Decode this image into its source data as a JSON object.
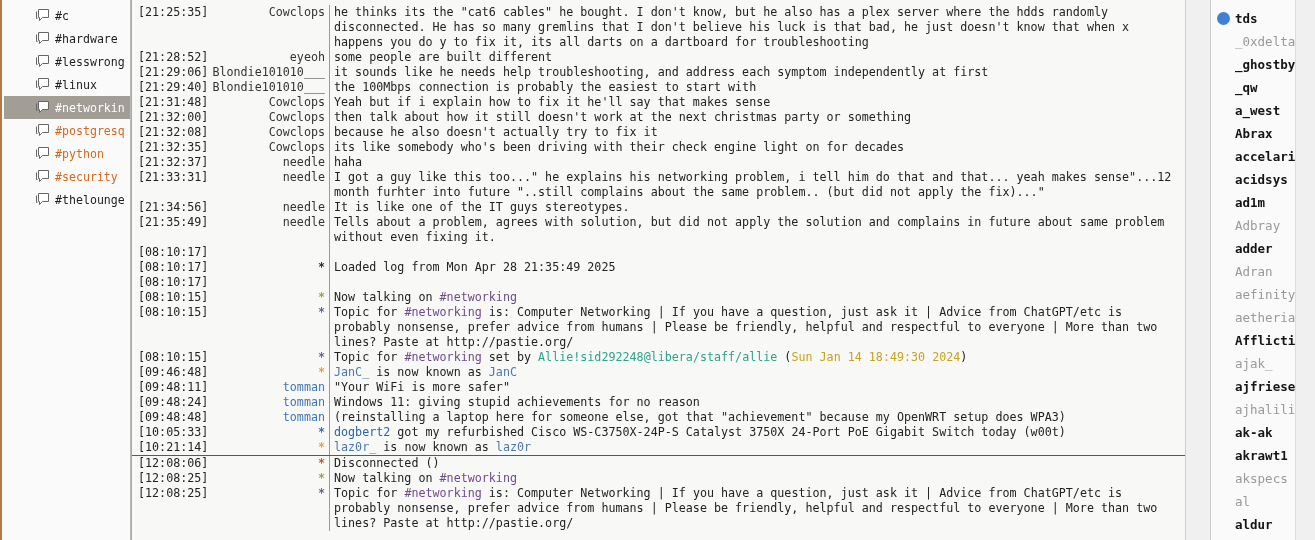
{
  "channels": [
    {
      "name": "#c",
      "selected": false,
      "color": "#1e1e1e"
    },
    {
      "name": "#hardware",
      "selected": false,
      "color": "#1e1e1e"
    },
    {
      "name": "#lesswrong",
      "selected": false,
      "color": "#1e1e1e"
    },
    {
      "name": "#linux",
      "selected": false,
      "color": "#1e1e1e"
    },
    {
      "name": "#networkin",
      "selected": true,
      "color": "#ffffff"
    },
    {
      "name": "#postgresq",
      "selected": false,
      "color": "#d2691e"
    },
    {
      "name": "#python",
      "selected": false,
      "color": "#d2691e"
    },
    {
      "name": "#security",
      "selected": false,
      "color": "#d2691e"
    },
    {
      "name": "#thelounge",
      "selected": false,
      "color": "#1e1e1e"
    }
  ],
  "chat": [
    {
      "kind": "message",
      "time": "[21:25:35]",
      "nick": "Cowclops",
      "color": "#333333",
      "parts": [
        {
          "text": "he thinks its the \"cat6 cables\" he bought. I don't know, but he also has a plex server where the hdds randomly disconnected. He has so many gremlins that I don't believe his luck is that bad, he just doesn't know that when x happens you do y to fix it, its all darts on a dartboard for troubleshooting"
        }
      ]
    },
    {
      "kind": "message",
      "time": "[21:28:52]",
      "nick": "eyeoh",
      "color": "#333333",
      "parts": [
        {
          "text": "some people are built different"
        }
      ]
    },
    {
      "kind": "message",
      "time": "[21:29:06]",
      "nick": "Blondie101010___",
      "color": "#333333",
      "parts": [
        {
          "text": "it sounds like he needs help troubleshooting, and address each symptom independently at first"
        }
      ]
    },
    {
      "kind": "message",
      "time": "[21:29:40]",
      "nick": "Blondie101010___",
      "color": "#333333",
      "parts": [
        {
          "text": "the 100Mbps connection is probably the easiest to start with"
        }
      ]
    },
    {
      "kind": "message",
      "time": "[21:31:48]",
      "nick": "Cowclops",
      "color": "#333333",
      "parts": [
        {
          "text": "Yeah but if i explain how to fix it he'll say that makes sense"
        }
      ]
    },
    {
      "kind": "message",
      "time": "[21:32:00]",
      "nick": "Cowclops",
      "color": "#333333",
      "parts": [
        {
          "text": "then talk about how it still doesn't work at the next christmas party or something"
        }
      ]
    },
    {
      "kind": "message",
      "time": "[21:32:08]",
      "nick": "Cowclops",
      "color": "#333333",
      "parts": [
        {
          "text": "because he also doesn't actually try to fix it"
        }
      ]
    },
    {
      "kind": "message",
      "time": "[21:32:35]",
      "nick": "Cowclops",
      "color": "#333333",
      "parts": [
        {
          "text": "its like somebody who's been driving with their check engine light on for decades"
        }
      ]
    },
    {
      "kind": "message",
      "time": "[21:32:37]",
      "nick": "needle",
      "color": "#333333",
      "parts": [
        {
          "text": "haha"
        }
      ]
    },
    {
      "kind": "message",
      "time": "[21:33:31]",
      "nick": "needle",
      "color": "#333333",
      "parts": [
        {
          "text": "I got a guy like this too...\" he explains his networking problem, i tell him do that and that... yeah makes sense\"...12 month furhter into future \"..still complains about the same problem.. (but did not apply the fix)...\""
        }
      ]
    },
    {
      "kind": "message",
      "time": "[21:34:56]",
      "nick": "needle",
      "color": "#333333",
      "parts": [
        {
          "text": "It is like one of the IT guys stereotypes."
        }
      ]
    },
    {
      "kind": "message",
      "time": "[21:35:49]",
      "nick": "needle",
      "color": "#333333",
      "parts": [
        {
          "text": "Tells about a problem, agrees with solution, but did not apply the solution and complains in future about same problem without even fixing it."
        }
      ]
    },
    {
      "kind": "message",
      "time": "[08:10:17]"
    },
    {
      "kind": "message",
      "time": "[08:10:17]",
      "nick": "*",
      "color": "#333333",
      "parts": [
        {
          "text": "Loaded log from Mon Apr 28 21:35:49 2025"
        }
      ]
    },
    {
      "kind": "message",
      "time": "[08:10:17]"
    },
    {
      "kind": "message",
      "time": "[08:10:15]",
      "nick": "*",
      "color": "#8fae3c",
      "parts": [
        {
          "text": "Now talking on "
        },
        {
          "text": "#networking",
          "color": "#6d4c8a"
        }
      ]
    },
    {
      "kind": "message",
      "time": "[08:10:15]",
      "nick": "*",
      "color": "#5a6a90",
      "parts": [
        {
          "text": "Topic for "
        },
        {
          "text": "#networking",
          "color": "#6d4c8a"
        },
        {
          "text": " is: Computer Networking | If you have a question, just ask it | Advice from ChatGPT/etc is probably nonsense, prefer advice from humans | Please be friendly, helpful and respectful to everyone | More than two lines? Paste at http://pastie.org/"
        }
      ]
    },
    {
      "kind": "message",
      "time": "[08:10:15]",
      "nick": "*",
      "color": "#5a6a90",
      "parts": [
        {
          "text": "Topic for "
        },
        {
          "text": "#networking",
          "color": "#6d4c8a"
        },
        {
          "text": " set by "
        },
        {
          "text": "Allie!sid292248@libera/staff/allie",
          "color": "#2aa58a"
        },
        {
          "text": " ("
        },
        {
          "text": "Sun Jan 14 18:49:30 2024",
          "color": "#c9a11c"
        },
        {
          "text": ")"
        }
      ]
    },
    {
      "kind": "message",
      "time": "[09:46:48]",
      "nick": "*",
      "color": "#e3a43a",
      "parts": [
        {
          "text": "JanC_",
          "color": "#4a78ab"
        },
        {
          "text": " is now known as "
        },
        {
          "text": "JanC",
          "color": "#4a78ab"
        }
      ]
    },
    {
      "kind": "message",
      "time": "[09:48:11]",
      "nick": "tomman",
      "color": "#3d78b8",
      "parts": [
        {
          "text": "\"Your WiFi is more safer\""
        }
      ]
    },
    {
      "kind": "message",
      "time": "[09:48:24]",
      "nick": "tomman",
      "color": "#3d78b8",
      "parts": [
        {
          "text": "Windows 11: giving stupid achievements for no reason"
        }
      ]
    },
    {
      "kind": "message",
      "time": "[09:48:48]",
      "nick": "tomman",
      "color": "#3d78b8",
      "parts": [
        {
          "text": "(reinstalling a laptop here for someone else, got that \"achievement\" because my OpenWRT setup does WPA3)"
        }
      ]
    },
    {
      "kind": "message",
      "time": "[10:05:33]",
      "nick": "*",
      "color": "#3d6fb0",
      "parts": [
        {
          "text": "dogbert2",
          "color": "#2c64a8"
        },
        {
          "text": " got my refurbished Cisco WS-C3750X-24P-S Catalyst 3750X 24-Port PoE Gigabit Switch today (w00t)"
        }
      ]
    },
    {
      "kind": "message",
      "time": "[10:21:14]",
      "nick": "*",
      "color": "#e3a43a",
      "parts": [
        {
          "text": "laz0r_",
          "color": "#4a78ab"
        },
        {
          "text": " is now known as "
        },
        {
          "text": "laz0r",
          "color": "#4a78ab"
        }
      ]
    },
    {
      "kind": "marker"
    },
    {
      "kind": "message",
      "time": "[12:08:06]",
      "nick": "*",
      "color": "#c65b1b",
      "parts": [
        {
          "text": "Disconnected ()"
        }
      ]
    },
    {
      "kind": "message",
      "time": "[12:08:25]",
      "nick": "*",
      "color": "#8fae3c",
      "parts": [
        {
          "text": "Now talking on "
        },
        {
          "text": "#networking",
          "color": "#6d4c8a"
        }
      ]
    },
    {
      "kind": "message",
      "time": "[12:08:25]",
      "nick": "*",
      "color": "#5a6a90",
      "parts": [
        {
          "text": "Topic for "
        },
        {
          "text": "#networking",
          "color": "#6d4c8a"
        },
        {
          "text": " is: Computer Networking | If you have a question, just ask it | Advice from ChatGPT/etc is probably nonsense, prefer advice from humans | Please be friendly, helpful and respectful to everyone | More than two lines? Paste at http://pastie.org/"
        }
      ]
    }
  ],
  "users": [
    {
      "nick": "tds",
      "away": false,
      "voiced": true
    },
    {
      "nick": "_0xdelta",
      "away": true,
      "voiced": false
    },
    {
      "nick": "_ghostby",
      "away": false,
      "voiced": false
    },
    {
      "nick": "_qw",
      "away": false,
      "voiced": false
    },
    {
      "nick": "a_west",
      "away": false,
      "voiced": false
    },
    {
      "nick": "Abrax",
      "away": false,
      "voiced": false
    },
    {
      "nick": "accelari",
      "away": false,
      "voiced": false
    },
    {
      "nick": "acidsys",
      "away": false,
      "voiced": false
    },
    {
      "nick": "ad1m",
      "away": false,
      "voiced": false
    },
    {
      "nick": "Adbray",
      "away": true,
      "voiced": false
    },
    {
      "nick": "adder",
      "away": false,
      "voiced": false
    },
    {
      "nick": "Adran",
      "away": true,
      "voiced": false
    },
    {
      "nick": "aefinity",
      "away": true,
      "voiced": false
    },
    {
      "nick": "aetheria",
      "away": true,
      "voiced": false
    },
    {
      "nick": "Afflicti",
      "away": false,
      "voiced": false
    },
    {
      "nick": "ajak_",
      "away": true,
      "voiced": false
    },
    {
      "nick": "ajfriese",
      "away": false,
      "voiced": false
    },
    {
      "nick": "ajhalili",
      "away": true,
      "voiced": false
    },
    {
      "nick": "ak-ak",
      "away": false,
      "voiced": false
    },
    {
      "nick": "akrawt1",
      "away": false,
      "voiced": false
    },
    {
      "nick": "akspecs",
      "away": true,
      "voiced": false
    },
    {
      "nick": "al",
      "away": true,
      "voiced": false
    },
    {
      "nick": "aldur",
      "away": false,
      "voiced": false
    }
  ]
}
